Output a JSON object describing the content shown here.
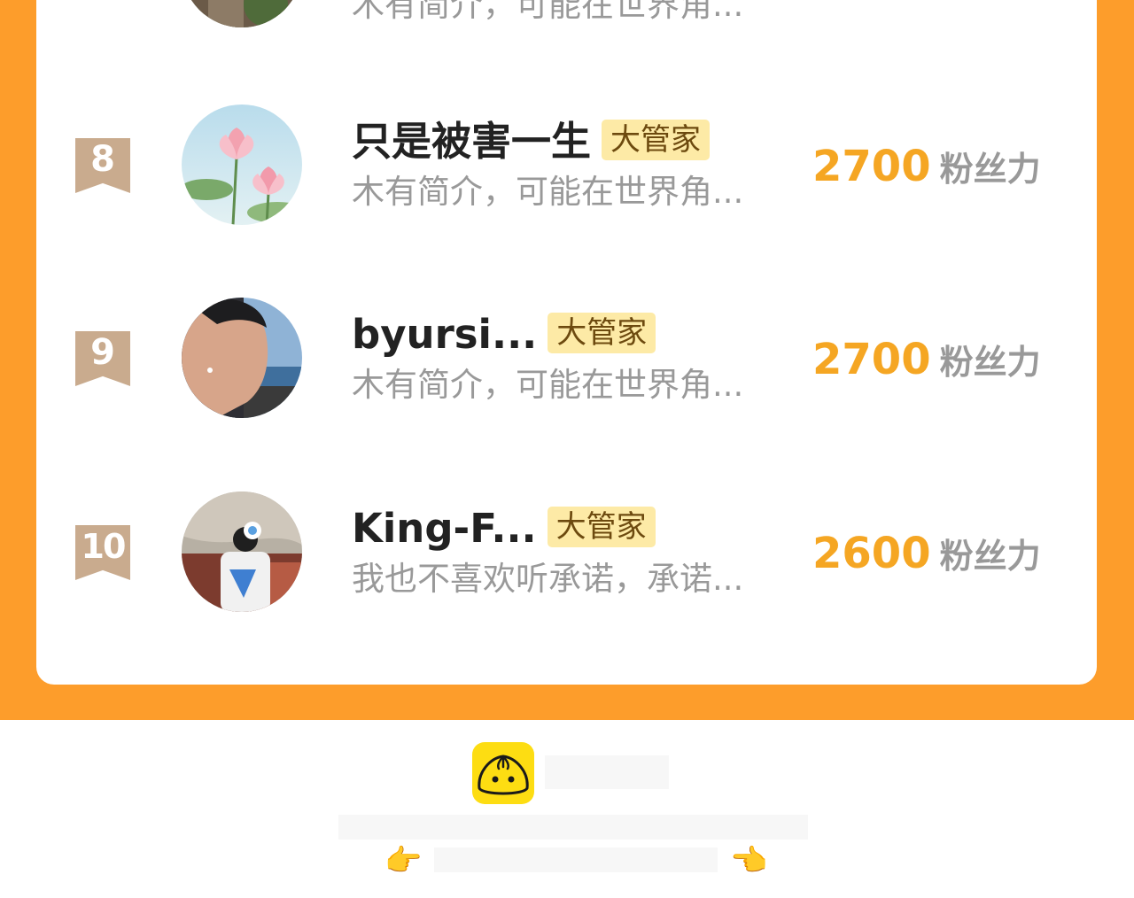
{
  "leaderboard": {
    "top_partial": {
      "bio": "木有简介，可能在世界角..."
    },
    "entries": [
      {
        "rank": "8",
        "name": "只是被害一生",
        "badge": "大管家",
        "bio": "木有简介，可能在世界角...",
        "score": "2700",
        "unit": "粉丝力"
      },
      {
        "rank": "9",
        "name": "byursi...",
        "badge": "大管家",
        "bio": "木有简介，可能在世界角...",
        "score": "2700",
        "unit": "粉丝力"
      },
      {
        "rank": "10",
        "name": "King-F...",
        "badge": "大管家",
        "bio": "我也不喜欢听承诺，承诺...",
        "score": "2600",
        "unit": "粉丝力"
      }
    ]
  },
  "footer": {
    "logo_icon": "bun-mascot-icon",
    "left_hand": "👉",
    "right_hand": "👈"
  },
  "colors": {
    "background_orange": "#fd9d2b",
    "score_orange": "#f5a623",
    "badge_bg": "#fdeaa6",
    "rank_ribbon": "#c9ab8e",
    "logo_yellow": "#fddd12"
  }
}
